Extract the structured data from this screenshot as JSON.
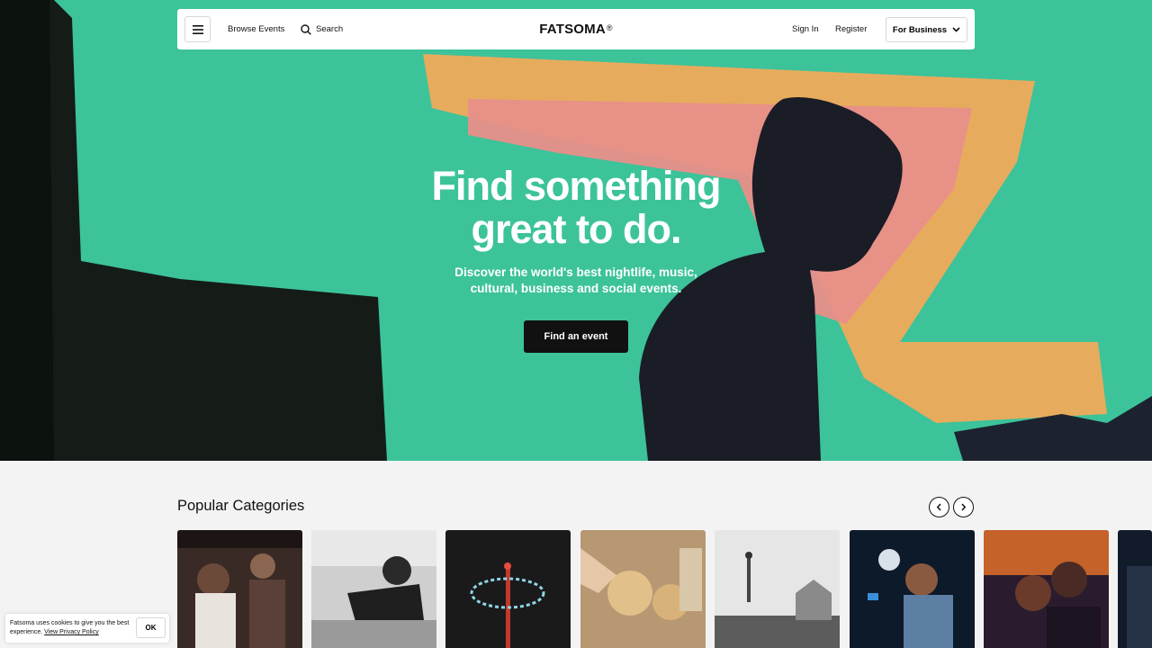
{
  "nav": {
    "browse_label": "Browse Events",
    "search_label": "Search",
    "logo_text": "FATSOMA",
    "logo_mark": "®",
    "signin_label": "Sign In",
    "register_label": "Register",
    "business_label": "For Business"
  },
  "hero": {
    "title": "Find something\ngreat to do.",
    "subtitle": "Discover the world's best nightlife, music,\ncultural, business and social events.",
    "cta_label": "Find an event"
  },
  "categories": {
    "title": "Popular Categories"
  },
  "cookie": {
    "text": "Fatsoma uses cookies to give you the best experience.",
    "link_text": "View Privacy Policy",
    "ok_label": "OK"
  },
  "colors": {
    "hero_green": "#3ec49a",
    "hero_orange": "#f2a95a",
    "hero_pink": "#e98a86",
    "button_dark": "#111111"
  }
}
